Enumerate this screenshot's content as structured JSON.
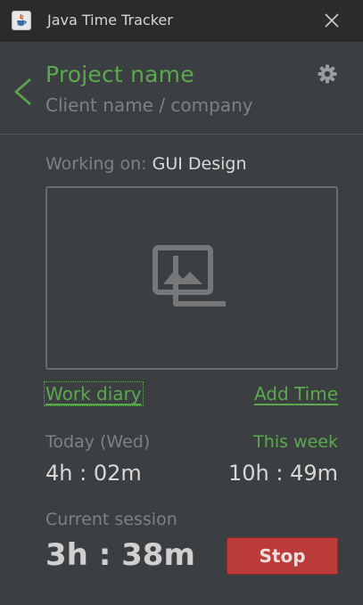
{
  "titlebar": {
    "title": "Java Time Tracker",
    "app_icon": "java-cup-icon",
    "close_icon": "close-icon"
  },
  "header": {
    "project_name": "Project name",
    "client_name": "Client name / company",
    "back_icon": "chevron-left-icon",
    "settings_icon": "gear-icon"
  },
  "work": {
    "label": "Working on:",
    "task": "GUI Design",
    "placeholder_icon": "image-gallery-icon"
  },
  "links": {
    "work_diary": "Work diary",
    "add_time": "Add Time"
  },
  "stats": {
    "today_label": "Today (Wed)",
    "today_value": "4h : 02m",
    "week_label": "This week",
    "week_value": "10h : 49m"
  },
  "session": {
    "label": "Current session",
    "value": "3h : 38m",
    "stop_label": "Stop"
  },
  "colors": {
    "background": "#3c3f41",
    "titlebar": "#2b2b2b",
    "accent_green": "#5ca84e",
    "stop_red": "#bb3b3b",
    "muted_text": "#7e8183",
    "primary_text": "#d8d8d8"
  }
}
